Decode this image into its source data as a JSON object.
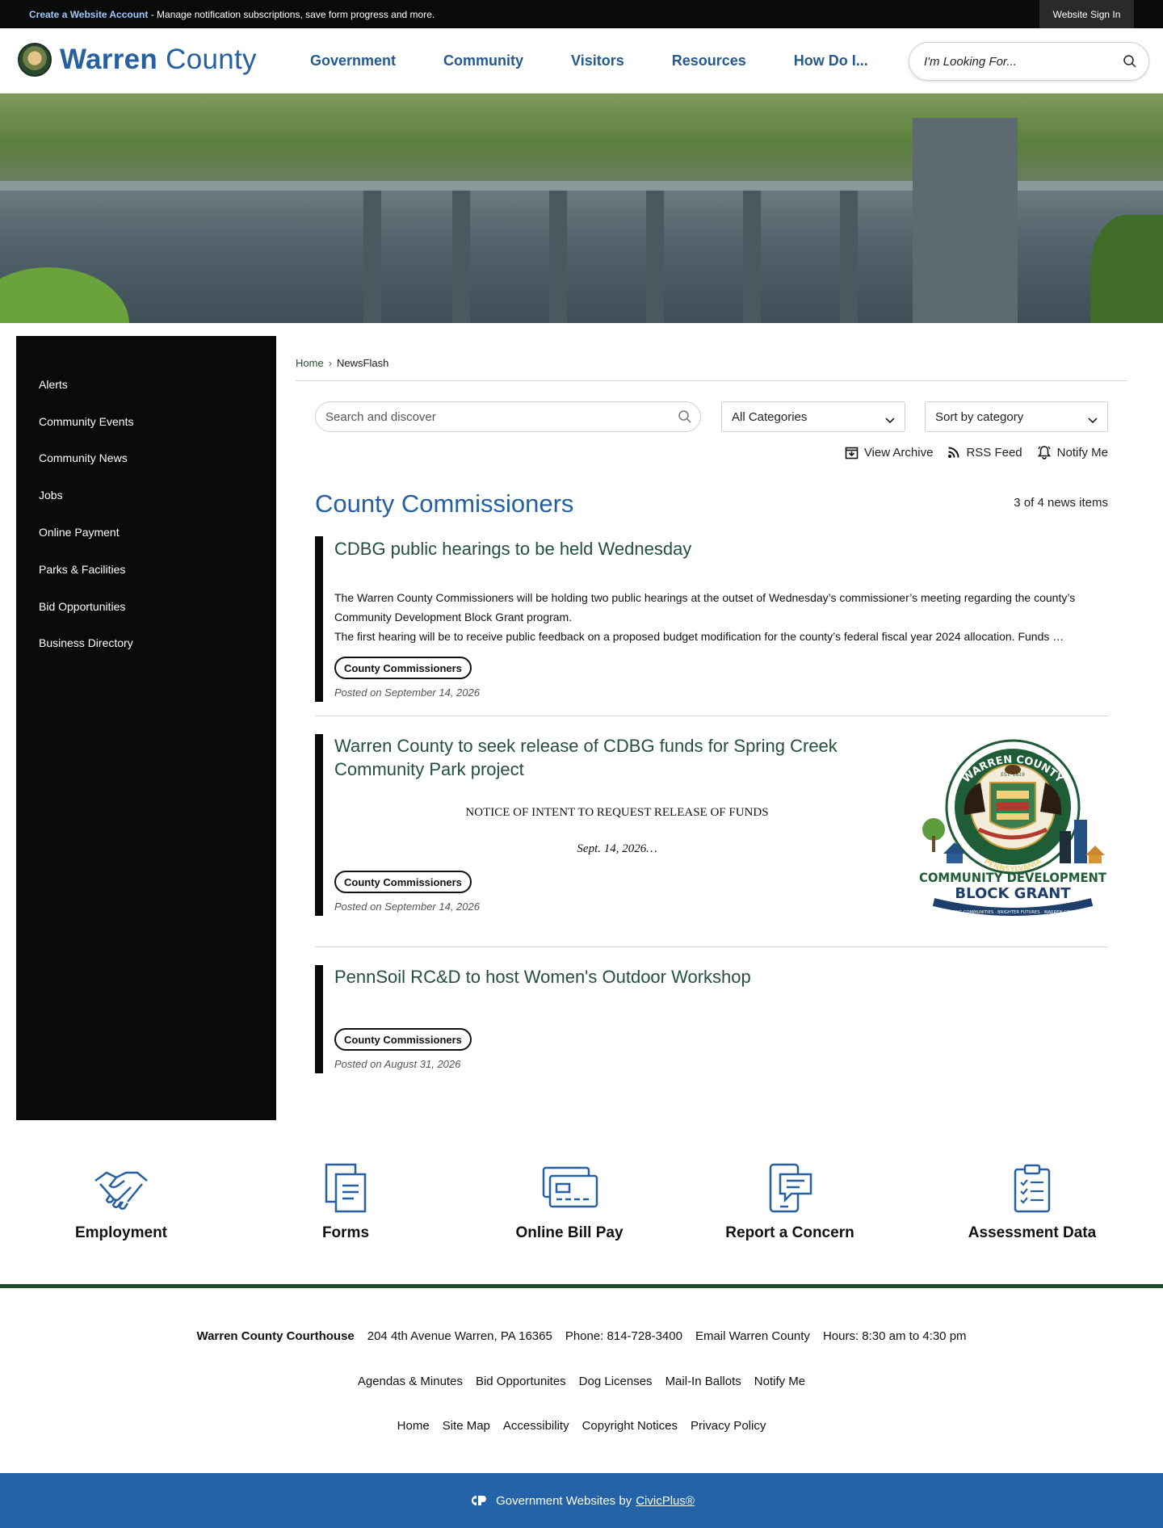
{
  "topbar": {
    "create_account_link": "Create a Website Account",
    "message": " - Manage notification subscriptions, save form progress and more.",
    "signin_label": "Website Sign In"
  },
  "header": {
    "logo_bold": "Warren",
    "logo_light": " County",
    "nav": [
      "Government",
      "Community",
      "Visitors",
      "Resources",
      "How Do I..."
    ],
    "search_placeholder": "I'm Looking For..."
  },
  "sidebar": {
    "items": [
      "Alerts",
      "Community Events",
      "Community News",
      "Jobs",
      "Online Payment",
      "Parks & Facilities",
      "Bid Opportunities",
      "Business Directory"
    ]
  },
  "breadcrumb": {
    "home": "Home",
    "separator": "›",
    "current": "NewsFlash"
  },
  "filters": {
    "search_placeholder": "Search and discover",
    "category_selected": "All Categories",
    "sort_selected": "Sort by category",
    "tools": [
      "View Archive",
      "RSS Feed",
      "Notify Me"
    ]
  },
  "category": {
    "title": "County Commissioners",
    "count": "3 of 4 news items"
  },
  "news": [
    {
      "title": "CDBG public hearings to be held Wednesday",
      "body_1": "The Warren County Commissioners will be holding two public hearings at the outset of Wednesday’s commissioner’s meeting regarding the county’s Community Development Block Grant program.",
      "body_2": "The first hearing will be to receive public feedback on a proposed budget modification for the county’s federal fiscal year 2024 allocation. Funds …",
      "tag": "County Commissioners",
      "posted": "Posted on September 14, 2026"
    },
    {
      "title": "Warren County to seek release of CDBG funds for Spring Creek Community Park project",
      "notice_1": "NOTICE OF INTENT TO REQUEST RELEASE OF FUNDS",
      "notice_2": "Sept. 14, 2026…",
      "tag": "County Commissioners",
      "posted": "Posted on September 14, 2026",
      "image": {
        "ring_top": "WARREN COUNTY",
        "est": "EST. 1819",
        "ring_bottom": "PENNSYLVANIA",
        "line_1": "COMMUNITY DEVELOPMENT",
        "line_2": "BLOCK GRANT",
        "tagline": "STRONG COMMUNITIES · BRIGHTER FUTURES · WARREN COUNTY"
      }
    },
    {
      "title": "PennSoil RC&D to host Women's Outdoor Workshop",
      "tag": "County Commissioners",
      "posted": "Posted on August 31, 2026"
    }
  ],
  "quick_links": [
    "Employment",
    "Forms",
    "Online Bill Pay",
    "Report a Concern",
    "Assessment Data"
  ],
  "footer": {
    "courthouse": "Warren County Courthouse",
    "address": "204 4th Avenue Warren, PA 16365",
    "phone": "Phone: 814-728-3400",
    "email": "Email Warren County",
    "hours": "Hours: 8:30 am to 4:30 pm",
    "links_1": [
      "Agendas & Minutes",
      "Bid Opportunites",
      "Dog Licenses",
      "Mail-In Ballots",
      "Notify Me"
    ],
    "links_2": [
      "Home",
      "Site Map",
      "Accessibility",
      "Copyright Notices",
      "Privacy Policy"
    ],
    "powered_by": "Government Websites by",
    "civicplus": "CivicPlus®"
  },
  "colors": {
    "brand_blue": "#2660a2",
    "nav_blue": "#245992",
    "title_green": "#24503a",
    "footer_blue": "#2463a8",
    "divider_green": "#1f4a2a"
  }
}
